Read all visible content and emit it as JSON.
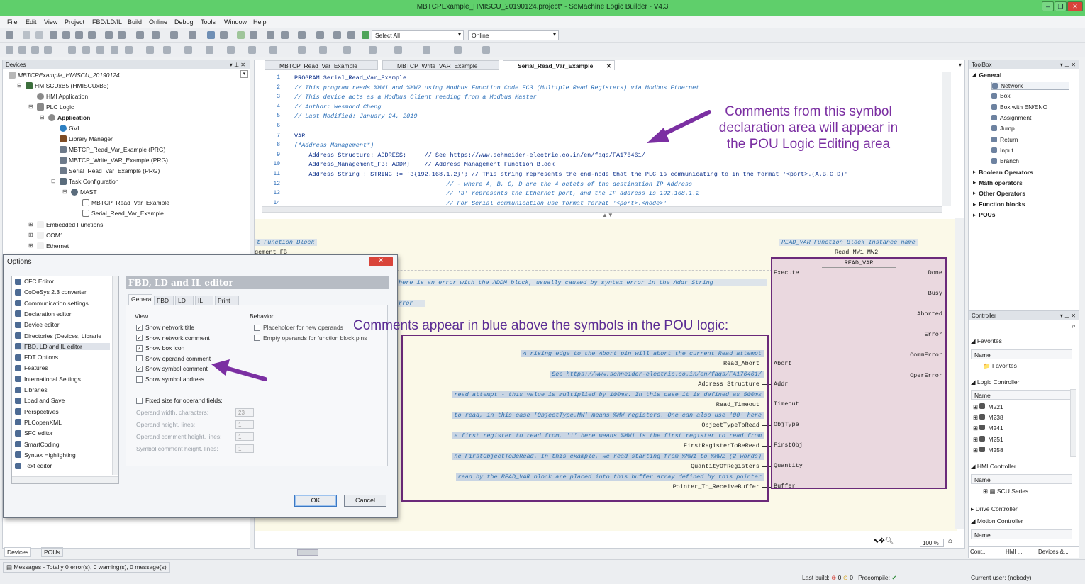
{
  "window": {
    "title": "MBTCPExample_HMISCU_20190124.project* - SoMachine Logic Builder - V4.3"
  },
  "menu": [
    "File",
    "Edit",
    "View",
    "Project",
    "FBD/LD/IL",
    "Build",
    "Online",
    "Debug",
    "Tools",
    "Window",
    "Help"
  ],
  "toolbar": {
    "select_combo": "Select All",
    "online_combo": "Online"
  },
  "devices": {
    "title": "Devices",
    "root": "MBTCPExample_HMISCU_20190124",
    "nodes": [
      "HMISCUxB5 (HMISCUxB5)",
      "HMI Application",
      "PLC Logic",
      "Application",
      "GVL",
      "Library Manager",
      "MBTCP_Read_Var_Example (PRG)",
      "MBTCP_Write_VAR_Example (PRG)",
      "Serial_Read_Var_Example (PRG)",
      "Task Configuration",
      "MAST",
      "MBTCP_Read_Var_Example",
      "Serial_Read_Var_Example",
      "Embedded Functions",
      "COM1",
      "Ethernet"
    ],
    "bottom_tabs": [
      "Devices",
      "POUs"
    ]
  },
  "editor": {
    "tabs": [
      "MBTCP_Read_Var_Example",
      "MBTCP_Write_VAR_Example",
      "Serial_Read_Var_Example"
    ],
    "decl_lines": [
      {
        "n": "1",
        "t": "PROGRAM Serial_Read_Var_Example"
      },
      {
        "n": "2",
        "t": "// This program reads %MW1 and %MW2 using Modbus Function Code FC3 (Multiple Read Registers) via Modbus Ethernet"
      },
      {
        "n": "3",
        "t": "// This device acts as a Modbus Client reading from a Modbus Master"
      },
      {
        "n": "4",
        "t": "// Author: Wesmond Cheng"
      },
      {
        "n": "5",
        "t": "// Last Modified: January 24, 2019"
      },
      {
        "n": "6",
        "t": ""
      },
      {
        "n": "7",
        "t": "VAR"
      },
      {
        "n": "8",
        "t": "(*Address Management*)"
      },
      {
        "n": "9",
        "t": "    Address_Structure: ADDRESS;     // See https://www.schneider-electric.co.in/en/faqs/FA176461/"
      },
      {
        "n": "10",
        "t": "    Address_Management_FB: ADDM;    // Address Management Function Block"
      },
      {
        "n": "11",
        "t": "    Address_String : STRING := '3{192.168.1.2}'; // This string represents the end-node that the PLC is communicating to in the format '<port>.(A.B.C.D)'"
      },
      {
        "n": "12",
        "t": "                                          // - where A, B, C, D are the 4 octets of the destination IP Address"
      },
      {
        "n": "13",
        "t": "                                          // '3' represents the Ethernet port, and the IP address is 192.168.1.2"
      },
      {
        "n": "14",
        "t": "                                          // For Serial communication use format format '<port>.<node>'"
      }
    ],
    "logic": {
      "left_title": "t Function Block",
      "left_sub": "gement_FB",
      "right_title": "READ_VAR Function Block Instance name",
      "instance": "Read_MW1_MW2",
      "block": "READ_VAR",
      "net_comments": [
        "here is an error with the ADDM block, usually caused by syntax error in the Addr String",
        "rror"
      ],
      "sym_comments": [
        "A rising edge to the Abort pin will abort the current Read attempt",
        "See https://www.schneider-electric.co.in/en/faqs/FA176461/",
        "read attempt - this value is multiplied by 100ms. In this case it is defined as 500ms",
        "to read, in this case 'ObjectType.MW' means %MW registers. One can also use '00' here",
        "e first register to read from, '1' here means %MW1 is the first register to read from",
        "he FirstObjectToBeRead. In this example, we read starting from %MW1 to %MW2 (2 words)",
        "read by the READ_VAR block are placed into this buffer array defined by this pointer"
      ],
      "operands": [
        "Read_Abort",
        "Address_Structure",
        "Read_Timeout",
        "ObjectTypeToRead",
        "FirstRegisterToBeRead",
        "QuantityOfRegisters",
        "Pointer_To_ReceiveBuffer"
      ],
      "inputs": [
        "Execute",
        "Abort",
        "Addr",
        "Timeout",
        "ObjType",
        "FirstObj",
        "Quantity",
        "Buffer"
      ],
      "outputs": [
        "Done",
        "Busy",
        "Aborted",
        "Error",
        "CommError",
        "OperError"
      ]
    },
    "zoom": "100 %"
  },
  "toolbox": {
    "title": "ToolBox",
    "general": "General",
    "items": [
      "Network",
      "Box",
      "Box with EN/ENO",
      "Assignment",
      "Jump",
      "Return",
      "Input",
      "Branch"
    ],
    "groups": [
      "Boolean Operators",
      "Math operators",
      "Other Operators",
      "Function blocks",
      "POUs"
    ]
  },
  "controller": {
    "title": "Controller",
    "favorites": "Favorites",
    "name": "Name",
    "fav_item": "Favorites",
    "logic_controller": "Logic Controller",
    "models": [
      "M221",
      "M238",
      "M241",
      "M251",
      "M258"
    ],
    "hmi_controller": "HMI Controller",
    "hmi_item": "SCU Series",
    "drive": "Drive Controller",
    "motion": "Motion Controller",
    "bottom_tabs": [
      "Cont...",
      "HMI ...",
      "Devices &..."
    ]
  },
  "options": {
    "title": "Options",
    "items": [
      "CFC Editor",
      "CoDeSys 2.3 converter",
      "Communication settings",
      "Declaration editor",
      "Device editor",
      "Directories (Devices, Librarie",
      "FBD, LD and IL editor",
      "FDT Options",
      "Features",
      "International Settings",
      "Libraries",
      "Load and Save",
      "Perspectives",
      "PLCopenXML",
      "SFC editor",
      "SmartCoding",
      "Syntax Highlighting",
      "Text editor"
    ],
    "heading": "FBD, LD and IL editor",
    "tabs": [
      "General",
      "FBD",
      "LD",
      "IL",
      "Print"
    ],
    "view_label": "View",
    "behavior_label": "Behavior",
    "view_checks": [
      {
        "label": "Show network title",
        "checked": true
      },
      {
        "label": "Show network comment",
        "checked": true
      },
      {
        "label": "Show box icon",
        "checked": true
      },
      {
        "label": "Show operand comment",
        "checked": false
      },
      {
        "label": "Show symbol comment",
        "checked": true
      },
      {
        "label": "Show symbol address",
        "checked": false
      }
    ],
    "behavior_checks": [
      {
        "label": "Placeholder for new operands",
        "checked": false
      },
      {
        "label": "Empty operands for function block pins",
        "checked": false
      }
    ],
    "fixed_size": "Fixed size for operand fields:",
    "fields": [
      {
        "label": "Operand width, characters:",
        "value": "23"
      },
      {
        "label": "Operand height, lines:",
        "value": "1"
      },
      {
        "label": "Operand comment height, lines:",
        "value": "1"
      },
      {
        "label": "Symbol comment height, lines:",
        "value": "1"
      }
    ],
    "ok": "OK",
    "cancel": "Cancel"
  },
  "annotations": {
    "top": "Comments from this symbol declaration area will appear in the POU Logic Editing area",
    "middle": "Comments appear in blue above the symbols in the POU logic:"
  },
  "status": {
    "messages": "Messages - Totally 0 error(s), 0 warning(s), 0 message(s)",
    "last_build": "Last build:",
    "err": "0",
    "warn": "0",
    "precompile": "Precompile:",
    "user": "Current user: (nobody)"
  },
  "colors": {
    "title_bar": "#5fcf6b",
    "annotation": "#7b2fa2",
    "block_border": "#6b2a7a"
  }
}
